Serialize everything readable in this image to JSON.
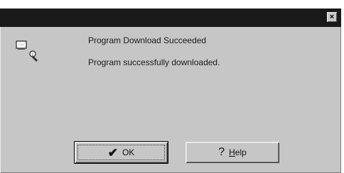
{
  "dialog": {
    "close_label": "×",
    "message_title": "Program Download Succeeded",
    "message_body": "Program successfully downloaded.",
    "icon": "computer-with-info-icon"
  },
  "buttons": {
    "ok": {
      "icon": "checkmark-icon",
      "glyph": "✔",
      "label": "OK"
    },
    "help": {
      "icon": "question-icon",
      "glyph": "?",
      "label_underlined": "H",
      "label_rest": "elp"
    }
  }
}
